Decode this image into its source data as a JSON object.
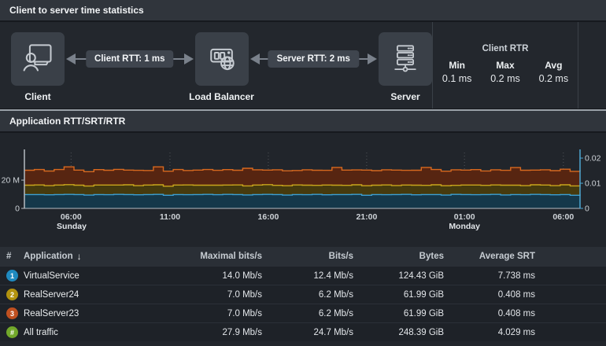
{
  "topology": {
    "title": "Client to server time statistics",
    "nodes": [
      {
        "label": "Client"
      },
      {
        "label": "Load Balancer"
      },
      {
        "label": "Server"
      }
    ],
    "links": [
      {
        "label": "Client RTT: 1 ms"
      },
      {
        "label": "Server RTT: 2 ms"
      }
    ],
    "client_rtr": {
      "title": "Client RTR",
      "stats": [
        {
          "label": "Min",
          "value": "0.1 ms"
        },
        {
          "label": "Max",
          "value": "0.2 ms"
        },
        {
          "label": "Avg",
          "value": "0.2 ms"
        }
      ]
    }
  },
  "chart_panel": {
    "title": "Application RTT/SRT/RTR"
  },
  "chart_data": {
    "type": "area",
    "stacked": true,
    "title": "Application RTT/SRT/RTR",
    "grid": "dotted-vertical",
    "legend_position": "none",
    "unit": "Mb/s",
    "left_axis": {
      "max": 39.5,
      "ticks": [
        {
          "label": "20 M",
          "value": 20
        },
        {
          "label": "0",
          "value": 0
        }
      ]
    },
    "right_axis": {
      "max": 0.0222,
      "color": "#4da7d3",
      "ticks": [
        {
          "label": "0.02",
          "value": 0.02
        },
        {
          "label": "0.01",
          "value": 0.01
        },
        {
          "label": "0",
          "value": 0
        }
      ]
    },
    "x_ticks": [
      {
        "label": "06:00",
        "pos": 0.084
      },
      {
        "label": "11:00",
        "pos": 0.262
      },
      {
        "label": "16:00",
        "pos": 0.439
      },
      {
        "label": "21:00",
        "pos": 0.616
      },
      {
        "label": "01:00",
        "pos": 0.792
      },
      {
        "label": "06:00",
        "pos": 0.97
      }
    ],
    "day_labels": [
      {
        "label": "Sunday",
        "pos": 0.085,
        "bold": true
      },
      {
        "label": "Monday",
        "pos": 0.792,
        "bold": true
      }
    ],
    "series": [
      {
        "name": "VirtualService",
        "line": "#3b9fd4",
        "fill": "#15384a",
        "values": [
          9.8,
          9.8,
          9.6,
          9.8,
          9.9,
          9.8,
          9.4,
          9.8,
          9.7,
          9.9,
          9.8,
          9.6,
          9.8,
          9.9,
          9.3,
          9.8,
          9.7,
          9.8,
          9.9,
          9.7,
          9.9,
          9.8,
          9.5,
          9.8,
          9.9,
          9.8,
          9.4,
          9.8,
          9.7,
          9.9,
          9.6,
          9.8,
          9.8,
          9.9,
          9.3,
          9.8,
          9.7,
          9.8,
          9.9,
          9.6,
          9.8,
          9.8,
          9.4,
          9.9,
          9.8,
          9.7,
          9.8,
          9.9,
          9.5,
          9.8,
          9.7,
          9.9,
          9.8,
          9.6,
          9.8,
          9.3,
          9.8
        ]
      },
      {
        "name": "RealServer24",
        "line": "#c9a51c",
        "fill": "#463a0e",
        "values": [
          6.6,
          6.8,
          6.5,
          6.7,
          6.9,
          6.6,
          6.4,
          6.7,
          6.8,
          6.6,
          6.9,
          6.5,
          6.7,
          6.8,
          6.4,
          6.7,
          6.9,
          6.6,
          6.5,
          6.7,
          6.6,
          6.8,
          6.4,
          6.7,
          6.9,
          6.5,
          6.6,
          6.8,
          6.7,
          6.4,
          6.9,
          6.6,
          6.5,
          6.8,
          6.7,
          6.6,
          6.9,
          6.4,
          6.6,
          6.8,
          6.5,
          6.9,
          6.6,
          6.4,
          6.7,
          6.8,
          6.5,
          6.7,
          6.9,
          6.6,
          6.4,
          6.8,
          6.7,
          6.5,
          6.9,
          6.6,
          6.7
        ]
      },
      {
        "name": "RealServer23",
        "line": "#d8691f",
        "fill": "#572511",
        "values": [
          10.6,
          10.9,
          10.3,
          11.0,
          12.6,
          10.7,
          10.2,
          10.9,
          10.5,
          11.1,
          10.4,
          10.8,
          10.3,
          12.7,
          10.6,
          11.0,
          10.2,
          10.7,
          11.1,
          10.5,
          10.9,
          10.4,
          12.5,
          10.8,
          10.3,
          11.0,
          10.6,
          10.2,
          10.9,
          10.7,
          10.4,
          12.6,
          10.8,
          10.5,
          11.1,
          10.3,
          10.7,
          10.9,
          10.4,
          10.6,
          12.7,
          10.8,
          10.3,
          11.0,
          10.6,
          10.9,
          10.2,
          10.7,
          10.5,
          12.5,
          10.9,
          10.4,
          10.8,
          10.6,
          11.0,
          10.3,
          10.7
        ]
      }
    ]
  },
  "table": {
    "columns": {
      "num": "#",
      "application": "Application",
      "maximal_bits": "Maximal bits/s",
      "bits": "Bits/s",
      "bytes": "Bytes",
      "avg_srt": "Average SRT"
    },
    "sort": {
      "column": "Application",
      "direction": "descending",
      "icon": "↓"
    },
    "rows": [
      {
        "badge": "1",
        "badge_color": "#1f8ac0",
        "application": "VirtualService",
        "maximal_bits": "14.0 Mb/s",
        "bits": "12.4 Mb/s",
        "bytes": "124.43 GiB",
        "avg_srt": "7.738 ms"
      },
      {
        "badge": "2",
        "badge_color": "#b2930f",
        "application": "RealServer24",
        "maximal_bits": "7.0 Mb/s",
        "bits": "6.2 Mb/s",
        "bytes": "61.99 GiB",
        "avg_srt": "0.408 ms"
      },
      {
        "badge": "3",
        "badge_color": "#c05020",
        "application": "RealServer23",
        "maximal_bits": "7.0 Mb/s",
        "bits": "6.2 Mb/s",
        "bytes": "61.99 GiB",
        "avg_srt": "0.408 ms"
      },
      {
        "badge": "#",
        "badge_color": "#72a82a",
        "application": "All traffic",
        "maximal_bits": "27.9 Mb/s",
        "bits": "24.7 Mb/s",
        "bytes": "248.39 GiB",
        "avg_srt": "4.029 ms"
      }
    ]
  }
}
